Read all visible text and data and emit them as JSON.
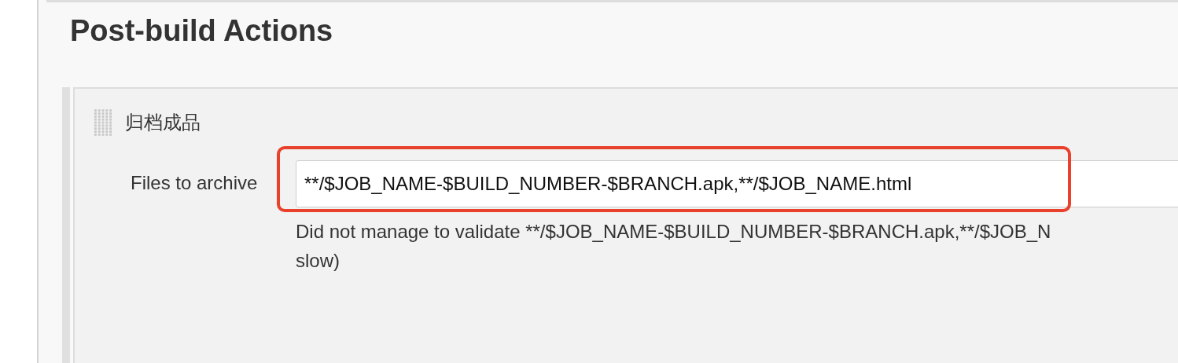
{
  "section": {
    "title": "Post-build Actions"
  },
  "step": {
    "title": "归档成品",
    "field": {
      "label": "Files to archive",
      "value": "**/$JOB_NAME-$BUILD_NUMBER-$BRANCH.apk,**/$JOB_NAME.html"
    },
    "validation": [
      "Did not manage to validate **/$JOB_NAME-$BUILD_NUMBER-$BRANCH.apk,**/$JOB_N",
      "slow)"
    ]
  }
}
